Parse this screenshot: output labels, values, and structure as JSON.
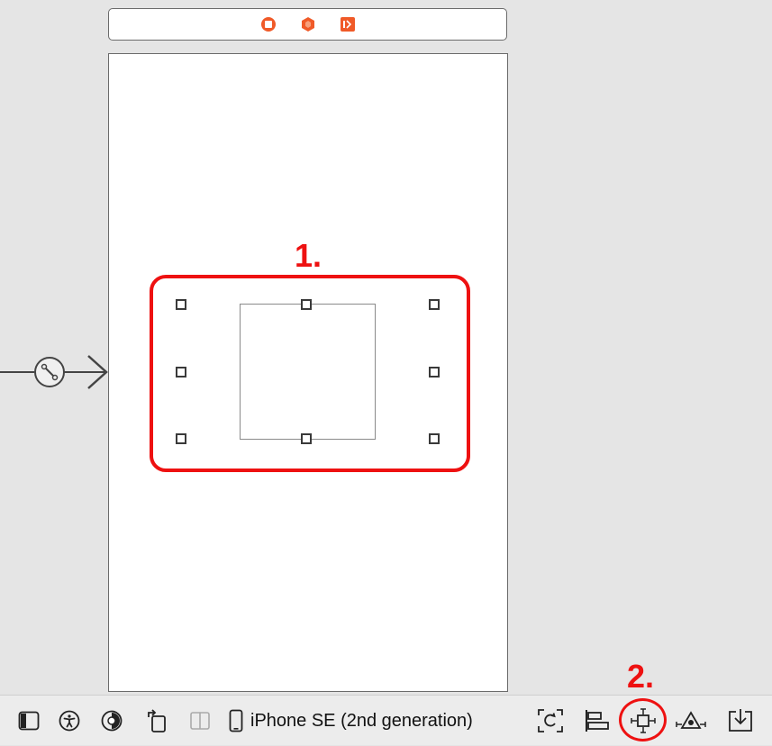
{
  "scene_dock": {
    "icons": [
      "view-controller-icon",
      "first-responder-icon",
      "exit-icon"
    ],
    "icon_color": "#f05a28"
  },
  "canvas": {
    "background": "#e5e5e5",
    "entry_point_icon": "storyboard-entry-point-arrow-icon"
  },
  "annotations": {
    "step1_label": "1.",
    "step2_label": "2.",
    "color": "#ee1111"
  },
  "toolbar": {
    "items": [
      "toggle-document-outline-icon",
      "accessibility-icon",
      "appearance-icon",
      "orientation-icon",
      "split-view-icon",
      "device-icon",
      "update-frames-icon",
      "align-icon",
      "add-constraints-icon",
      "resolve-autolayout-issues-icon",
      "embed-in-icon"
    ],
    "device_name": "iPhone SE (2nd generation)"
  }
}
